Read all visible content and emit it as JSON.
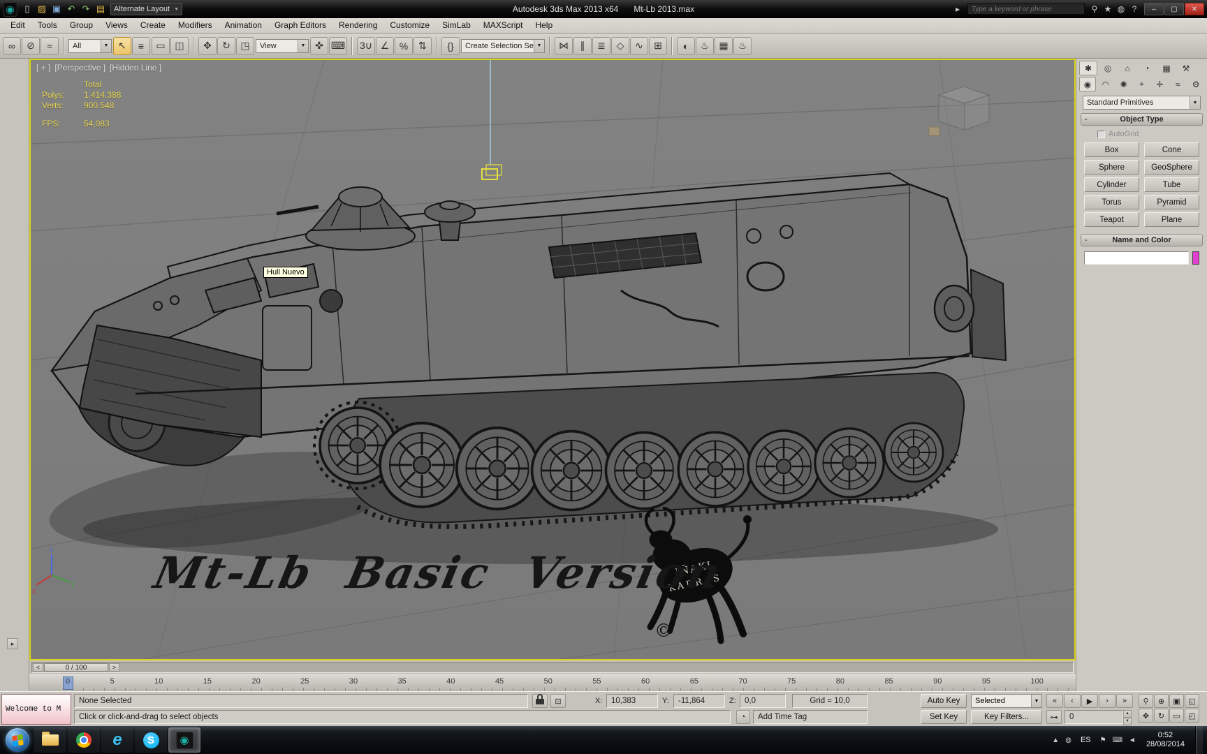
{
  "icons": {
    "dropdown_arrow": "▼"
  },
  "titlebar": {
    "logo_glyph": "◉",
    "layout_dropdown": "Alternate Layout",
    "app_title": "Autodesk 3ds Max  2013 x64",
    "file_name": "Mt-Lb 2013.max",
    "search_placeholder": "Type a keyword or phrase",
    "flyout_glyph": "▸",
    "quick_icons": [
      {
        "name": "new-scene-icon",
        "glyph": "▯"
      },
      {
        "name": "open-file-icon",
        "glyph": "▨",
        "cls": "c-folder"
      },
      {
        "name": "save-file-icon",
        "glyph": "▣",
        "cls": "c-save"
      },
      {
        "name": "undo-icon",
        "glyph": "↶",
        "cls": "c-undo"
      },
      {
        "name": "redo-icon",
        "glyph": "↷",
        "cls": "c-undo"
      },
      {
        "name": "project-folder-icon",
        "glyph": "▤",
        "cls": "c-folder"
      }
    ],
    "right_icons": [
      {
        "name": "search-icon",
        "glyph": "⚲"
      },
      {
        "name": "favorites-star-icon",
        "glyph": "★"
      },
      {
        "name": "communication-center-icon",
        "glyph": "◍"
      },
      {
        "name": "help-icon",
        "glyph": "?"
      }
    ],
    "window_buttons": [
      {
        "name": "minimize-button",
        "glyph": "–"
      },
      {
        "name": "maximize-button",
        "glyph": "▢"
      },
      {
        "name": "close-button",
        "glyph": "✕",
        "cls": "close"
      }
    ]
  },
  "menus": [
    {
      "name": "menu-edit",
      "label": "Edit"
    },
    {
      "name": "menu-tools",
      "label": "Tools"
    },
    {
      "name": "menu-group",
      "label": "Group"
    },
    {
      "name": "menu-views",
      "label": "Views"
    },
    {
      "name": "menu-create",
      "label": "Create"
    },
    {
      "name": "menu-modifiers",
      "label": "Modifiers"
    },
    {
      "name": "menu-animation",
      "label": "Animation"
    },
    {
      "name": "menu-graph-editors",
      "label": "Graph Editors"
    },
    {
      "name": "menu-rendering",
      "label": "Rendering"
    },
    {
      "name": "menu-customize",
      "label": "Customize"
    },
    {
      "name": "menu-simlab",
      "label": "SimLab"
    },
    {
      "name": "menu-maxscript",
      "label": "MAXScript"
    },
    {
      "name": "menu-help",
      "label": "Help"
    }
  ],
  "toolbar": {
    "filter_dropdown": "All",
    "reference_dropdown": "View",
    "selection_set_dropdown": "Create Selection Se",
    "icons_link": [
      {
        "name": "select-and-link-icon",
        "glyph": "∞"
      },
      {
        "name": "unlink-selection-icon",
        "glyph": "⊘"
      },
      {
        "name": "bind-to-space-warp-icon",
        "glyph": "≈"
      }
    ],
    "icons_select": [
      {
        "name": "select-object-icon",
        "glyph": "↖",
        "cls": "active"
      },
      {
        "name": "select-by-name-icon",
        "glyph": "≡"
      }
    ],
    "icons_region": [
      {
        "name": "rectangular-selection-region-icon",
        "glyph": "▭"
      },
      {
        "name": "window-crossing-toggle-icon",
        "glyph": "◫"
      }
    ],
    "icons_transform": [
      {
        "name": "select-and-move-icon",
        "glyph": "✥"
      },
      {
        "name": "select-and-rotate-icon",
        "glyph": "↻"
      },
      {
        "name": "select-and-scale-icon",
        "glyph": "◳"
      }
    ],
    "icons_manip": [
      {
        "name": "select-and-manipulate-icon",
        "glyph": "✜"
      },
      {
        "name": "keyboard-shortcut-override-icon",
        "glyph": "⌨"
      }
    ],
    "icons_snap": [
      {
        "name": "snaps-toggle-icon",
        "glyph": "3∪"
      },
      {
        "name": "angle-snap-toggle-icon",
        "glyph": "∠"
      },
      {
        "name": "percent-snap-toggle-icon",
        "glyph": "%"
      },
      {
        "name": "spinner-snap-toggle-icon",
        "glyph": "⇅"
      }
    ],
    "icons_sets": [
      {
        "name": "edit-named-selection-sets-icon",
        "glyph": "{}"
      }
    ],
    "icons_tools": [
      {
        "name": "mirror-icon",
        "glyph": "⋈"
      },
      {
        "name": "align-icon",
        "glyph": "∥"
      },
      {
        "name": "layer-manager-icon",
        "glyph": "≣"
      },
      {
        "name": "graphite-ribbon-icon",
        "glyph": "◇"
      },
      {
        "name": "curve-editor-icon",
        "glyph": "∿"
      },
      {
        "name": "schematic-view-icon",
        "glyph": "⊞"
      }
    ],
    "icons_render": [
      {
        "name": "material-editor-icon",
        "glyph": "◐"
      },
      {
        "name": "render-setup-icon",
        "glyph": "♨"
      },
      {
        "name": "rendered-frame-window-icon",
        "glyph": "▦"
      },
      {
        "name": "render-production-icon",
        "glyph": "♨"
      }
    ]
  },
  "viewport": {
    "menu_general": "[ + ]",
    "menu_pov": "[Perspective ]",
    "menu_shading": "[Hidden Line ]",
    "stats": {
      "total_label": "Total",
      "polys_label": "Polys:",
      "polys_value": "1.414.388",
      "verts_label": "Verts:",
      "verts_value": "900.548",
      "fps_label": "FPS:",
      "fps_value": "54,083"
    },
    "tooltip": "Hull Nuevo",
    "watermark": "Mt-Lb Basic Version",
    "logo_line1": "IÑAKI",
    "logo_line2": "KARRAS",
    "copyright": "©",
    "axis_x": "x",
    "axis_y": "y",
    "axis_z": "z"
  },
  "left_strip": {
    "expand_glyph": "▸"
  },
  "command_panel": {
    "tabs": [
      {
        "name": "tab-create",
        "glyph": "✱",
        "cls": "active"
      },
      {
        "name": "tab-modify",
        "glyph": "◎"
      },
      {
        "name": "tab-hierarchy",
        "glyph": "⌂"
      },
      {
        "name": "tab-motion",
        "glyph": "◔"
      },
      {
        "name": "tab-display",
        "glyph": "▦"
      },
      {
        "name": "tab-utilities",
        "glyph": "⚒"
      }
    ],
    "categories": [
      {
        "name": "category-geometry",
        "glyph": "◉",
        "cls": "active"
      },
      {
        "name": "category-shapes",
        "glyph": "◠"
      },
      {
        "name": "category-lights",
        "glyph": "✺"
      },
      {
        "name": "category-cameras",
        "glyph": "⌖"
      },
      {
        "name": "category-helpers",
        "glyph": "✛"
      },
      {
        "name": "category-space-warps",
        "glyph": "≈"
      },
      {
        "name": "category-systems",
        "glyph": "⚙"
      }
    ],
    "category_dropdown": "Standard Primitives",
    "collapse_glyph": "-",
    "object_type_label": "Object Type",
    "autogrid_label": "AutoGrid",
    "object_buttons": [
      {
        "name": "box-button",
        "label": "Box"
      },
      {
        "name": "cone-button",
        "label": "Cone"
      },
      {
        "name": "sphere-button",
        "label": "Sphere"
      },
      {
        "name": "geosphere-button",
        "label": "GeoSphere"
      },
      {
        "name": "cylinder-button",
        "label": "Cylinder"
      },
      {
        "name": "tube-button",
        "label": "Tube"
      },
      {
        "name": "torus-button",
        "label": "Torus"
      },
      {
        "name": "pyramid-button",
        "label": "Pyramid"
      },
      {
        "name": "teapot-button",
        "label": "Teapot"
      },
      {
        "name": "plane-button",
        "label": "Plane"
      }
    ],
    "name_color_label": "Name and Color"
  },
  "timeline": {
    "prev_glyph": "<",
    "next_glyph": ">",
    "slider_label": "0 / 100",
    "ticks": [
      "0",
      "5",
      "10",
      "15",
      "20",
      "25",
      "30",
      "35",
      "40",
      "45",
      "50",
      "55",
      "60",
      "65",
      "70",
      "75",
      "80",
      "85",
      "90",
      "95",
      "100"
    ]
  },
  "status_bar": {
    "welcome_window": "Welcome to M",
    "selection_status": "None Selected",
    "prompt": "Click or click-and-drag to select objects",
    "absolute_mode_glyph": "⊡",
    "x_label": "X:",
    "x_value": "10,383",
    "y_label": "Y:",
    "y_value": "-11,864",
    "z_label": "Z:",
    "z_value": "0,0",
    "grid_value": "Grid = 10,0",
    "tag_icon_glyph": "◔",
    "add_time_tag": "Add Time Tag",
    "auto_key": "Auto Key",
    "set_key": "Set Key",
    "key_mode_dropdown": "Selected",
    "key_filters": "Key Filters...",
    "frame_value": "0",
    "spinner_up": "▲",
    "spinner_down": "▼",
    "playback": [
      {
        "name": "go-to-start-button",
        "glyph": "«"
      },
      {
        "name": "previous-frame-button",
        "glyph": "‹"
      },
      {
        "name": "play-animation-button",
        "glyph": "▶"
      },
      {
        "name": "next-frame-button",
        "glyph": "›"
      },
      {
        "name": "go-to-end-button",
        "glyph": "»"
      }
    ],
    "key_mode_glyph": "⊶",
    "nav": [
      {
        "name": "zoom-button",
        "glyph": "⚲"
      },
      {
        "name": "zoom-all-button",
        "glyph": "⊕"
      },
      {
        "name": "zoom-extents-button",
        "glyph": "▣"
      },
      {
        "name": "zoom-extents-all-button",
        "glyph": "◱"
      },
      {
        "name": "pan-button",
        "glyph": "✥"
      },
      {
        "name": "orbit-button",
        "glyph": "↻"
      },
      {
        "name": "zoom-region-button",
        "glyph": "▭"
      },
      {
        "name": "maximize-viewport-toggle-button",
        "glyph": "◰"
      }
    ]
  },
  "taskbar": {
    "ie_glyph": "e",
    "skype_glyph": "S",
    "max_glyph": "◉",
    "tray_left": [
      {
        "name": "hidden-icons-button",
        "glyph": "▲"
      },
      {
        "name": "tray-app-icon",
        "glyph": "◍"
      }
    ],
    "language": "ES",
    "tray_right": [
      {
        "name": "action-center-icon",
        "glyph": "⚑"
      },
      {
        "name": "keyboard-layout-icon",
        "glyph": "⌨"
      },
      {
        "name": "volume-icon",
        "glyph": "◄"
      }
    ],
    "time": "0:52",
    "date": "28/08/2014"
  }
}
